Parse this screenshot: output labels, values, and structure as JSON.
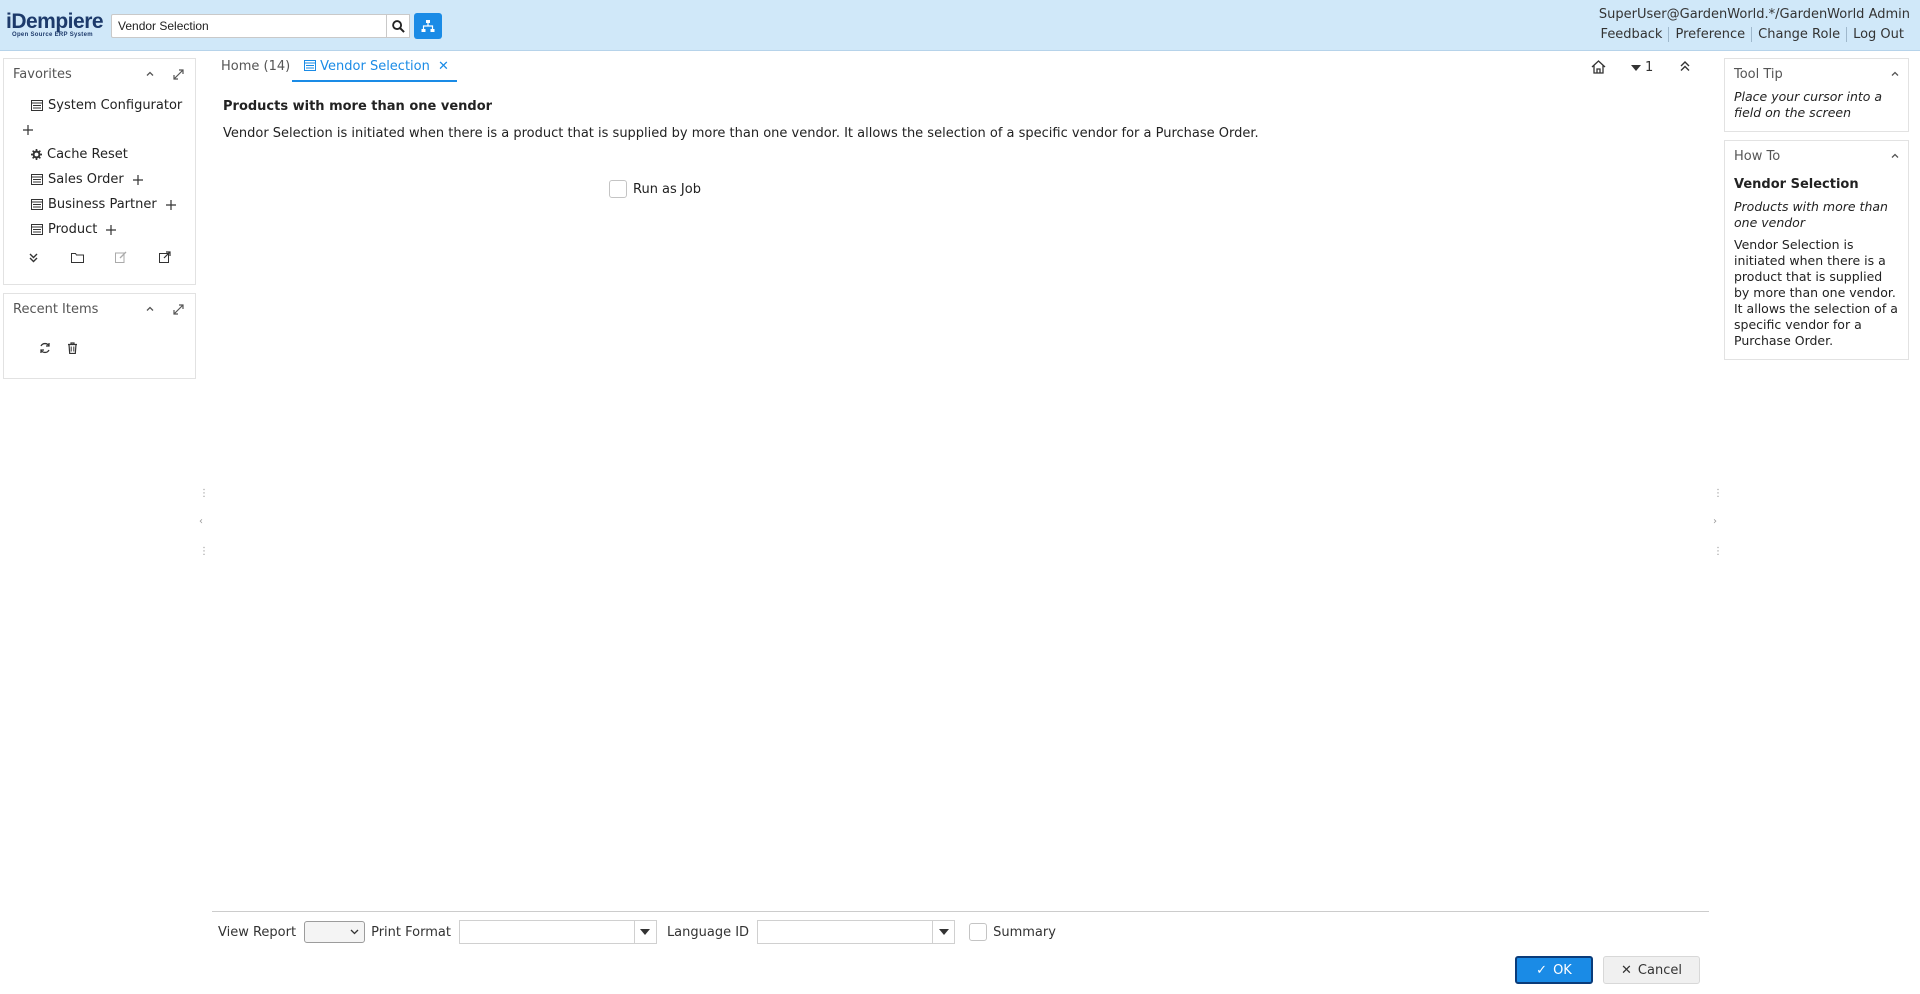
{
  "header": {
    "logo_main": "iDempiere",
    "logo_sub": "Open Source ERP System",
    "search_value": "Vendor Selection",
    "user": "SuperUser@GardenWorld.*/GardenWorld Admin",
    "links": [
      "Feedback",
      "Preference",
      "Change Role",
      "Log Out"
    ]
  },
  "favorites": {
    "title": "Favorites",
    "items": [
      {
        "label": "System Configurator",
        "icon": "window-icon"
      },
      {
        "label": "Cache Reset",
        "icon": "gear-icon"
      },
      {
        "label": "Sales Order",
        "icon": "window-icon"
      },
      {
        "label": "Business Partner",
        "icon": "window-icon"
      },
      {
        "label": "Product",
        "icon": "window-icon"
      }
    ]
  },
  "recent": {
    "title": "Recent Items"
  },
  "tabs": {
    "home": "Home (14)",
    "active": "Vendor Selection",
    "window_count": "1"
  },
  "content": {
    "title": "Products with more than one vendor",
    "description": "Vendor Selection is initiated when there is a product that is supplied by more than one vendor. It allows the selection of a specific vendor for a Purchase Order.",
    "run_as_job": "Run as Job"
  },
  "bottom": {
    "view_report": "View Report",
    "print_format": "Print Format",
    "language_id": "Language ID",
    "summary": "Summary",
    "ok": "OK",
    "cancel": "Cancel"
  },
  "tooltip": {
    "title": "Tool Tip",
    "text": "Place your cursor into a field on the screen"
  },
  "howto": {
    "title": "How To",
    "heading": "Vendor Selection",
    "subtitle": "Products with more than one vendor",
    "text": "Vendor Selection is initiated when there is a product that is supplied by more than one vendor. It allows the selection of a specific vendor for a Purchase Order."
  },
  "colors": {
    "accent": "#1a8be6",
    "header_bg": "#d0e8f9"
  }
}
